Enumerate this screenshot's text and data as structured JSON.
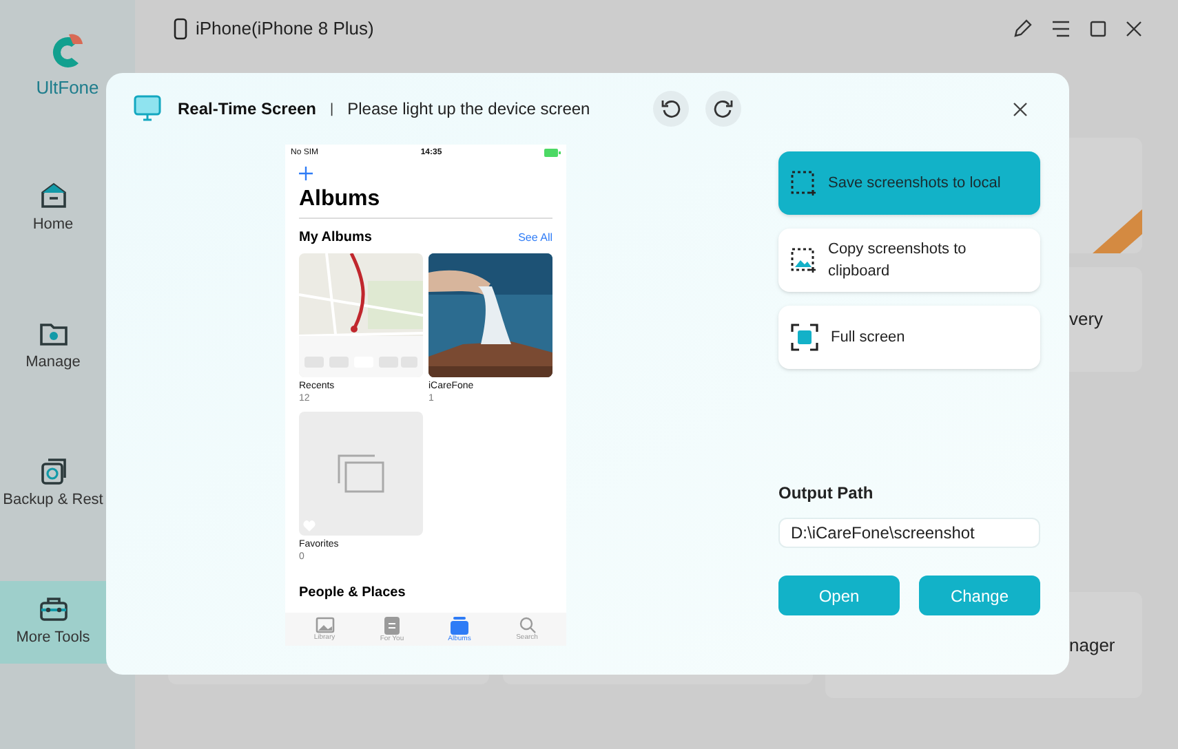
{
  "app": {
    "logo_text": "UltFone",
    "device": "iPhone(iPhone 8 Plus)",
    "nav": [
      {
        "label": "Home",
        "kind": "home",
        "selected": false
      },
      {
        "label": "Manage",
        "kind": "manage",
        "selected": false
      },
      {
        "label": "Backup & Rest",
        "kind": "backup",
        "selected": false
      },
      {
        "label": "More Tools",
        "kind": "tools",
        "selected": true
      }
    ],
    "background_cards": [
      {
        "label": "very"
      },
      {
        "label": "nager"
      }
    ]
  },
  "dialog": {
    "title": "Real-Time Screen",
    "separator": "|",
    "status": "Please light up the device screen",
    "modes": [
      {
        "label": "Save screenshots to local",
        "kind": "save",
        "selected": true
      },
      {
        "label": "Copy screenshots to clipboard",
        "kind": "copy",
        "selected": false
      },
      {
        "label": "Full screen",
        "kind": "full",
        "selected": false
      }
    ],
    "output_label": "Output Path",
    "output_path": "D:\\iCareFone\\screenshot",
    "buttons": [
      "Open",
      "Change"
    ]
  },
  "phone": {
    "carrier": "No SIM",
    "time": "14:35",
    "title": "Albums",
    "section": "My Albums",
    "see_all": "See All",
    "albums": [
      {
        "name": "Recents",
        "count": "12",
        "kind": "map"
      },
      {
        "name": "iCareFone",
        "count": "1"
      },
      {
        "name": "Favorites",
        "count": "0",
        "kind": "empty"
      }
    ],
    "next_section": "People & Places",
    "tabs": [
      {
        "label": "Library",
        "kind": "library",
        "selected": false
      },
      {
        "label": "For You",
        "kind": "foryou",
        "selected": false
      },
      {
        "label": "Albums",
        "kind": "albums",
        "selected": true
      },
      {
        "label": "Search",
        "kind": "search",
        "selected": false
      }
    ]
  }
}
